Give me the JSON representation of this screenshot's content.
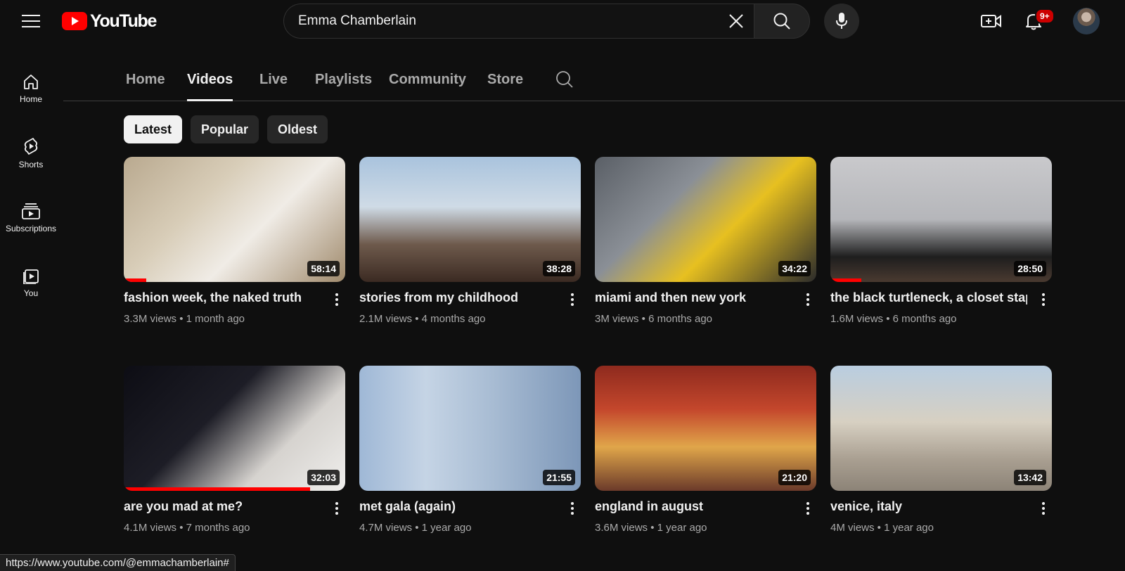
{
  "header": {
    "logo_text": "YouTube",
    "search": {
      "value": "Emma Chamberlain",
      "placeholder": "Search"
    },
    "notification_count": "9+"
  },
  "sidebar": {
    "items": [
      {
        "label": "Home",
        "icon": "home-icon"
      },
      {
        "label": "Shorts",
        "icon": "shorts-icon"
      },
      {
        "label": "Subscriptions",
        "icon": "subscriptions-icon"
      },
      {
        "label": "You",
        "icon": "you-icon"
      }
    ]
  },
  "tabs": [
    {
      "label": "Home",
      "active": false
    },
    {
      "label": "Videos",
      "active": true
    },
    {
      "label": "Live",
      "active": false
    },
    {
      "label": "Playlists",
      "active": false
    },
    {
      "label": "Community",
      "active": false
    },
    {
      "label": "Store",
      "active": false
    }
  ],
  "chips": [
    {
      "label": "Latest",
      "selected": true
    },
    {
      "label": "Popular",
      "selected": false
    },
    {
      "label": "Oldest",
      "selected": false
    }
  ],
  "videos": [
    {
      "title": "fashion week, the naked truth",
      "views": "3.3M views",
      "age": "1 month ago",
      "duration": "58:14",
      "watched_fraction": 0.1
    },
    {
      "title": "stories from my childhood",
      "views": "2.1M views",
      "age": "4 months ago",
      "duration": "38:28",
      "watched_fraction": 0
    },
    {
      "title": "miami and then new york",
      "views": "3M views",
      "age": "6 months ago",
      "duration": "34:22",
      "watched_fraction": 0
    },
    {
      "title": "the black turtleneck, a closet staple",
      "views": "1.6M views",
      "age": "6 months ago",
      "duration": "28:50",
      "watched_fraction": 0.14
    },
    {
      "title": "are you mad at me?",
      "views": "4.1M views",
      "age": "7 months ago",
      "duration": "32:03",
      "watched_fraction": 0.84
    },
    {
      "title": "met gala (again)",
      "views": "4.7M views",
      "age": "1 year ago",
      "duration": "21:55",
      "watched_fraction": 0
    },
    {
      "title": "england in august",
      "views": "3.6M views",
      "age": "1 year ago",
      "duration": "21:20",
      "watched_fraction": 0
    },
    {
      "title": "venice, italy",
      "views": "4M views",
      "age": "1 year ago",
      "duration": "13:42",
      "watched_fraction": 0
    }
  ],
  "status_url": "https://www.youtube.com/@emmachamberlain#",
  "colors": {
    "accent": "#ff0000",
    "background": "#0f0f0f",
    "chip_selected": "#f1f1f1"
  }
}
